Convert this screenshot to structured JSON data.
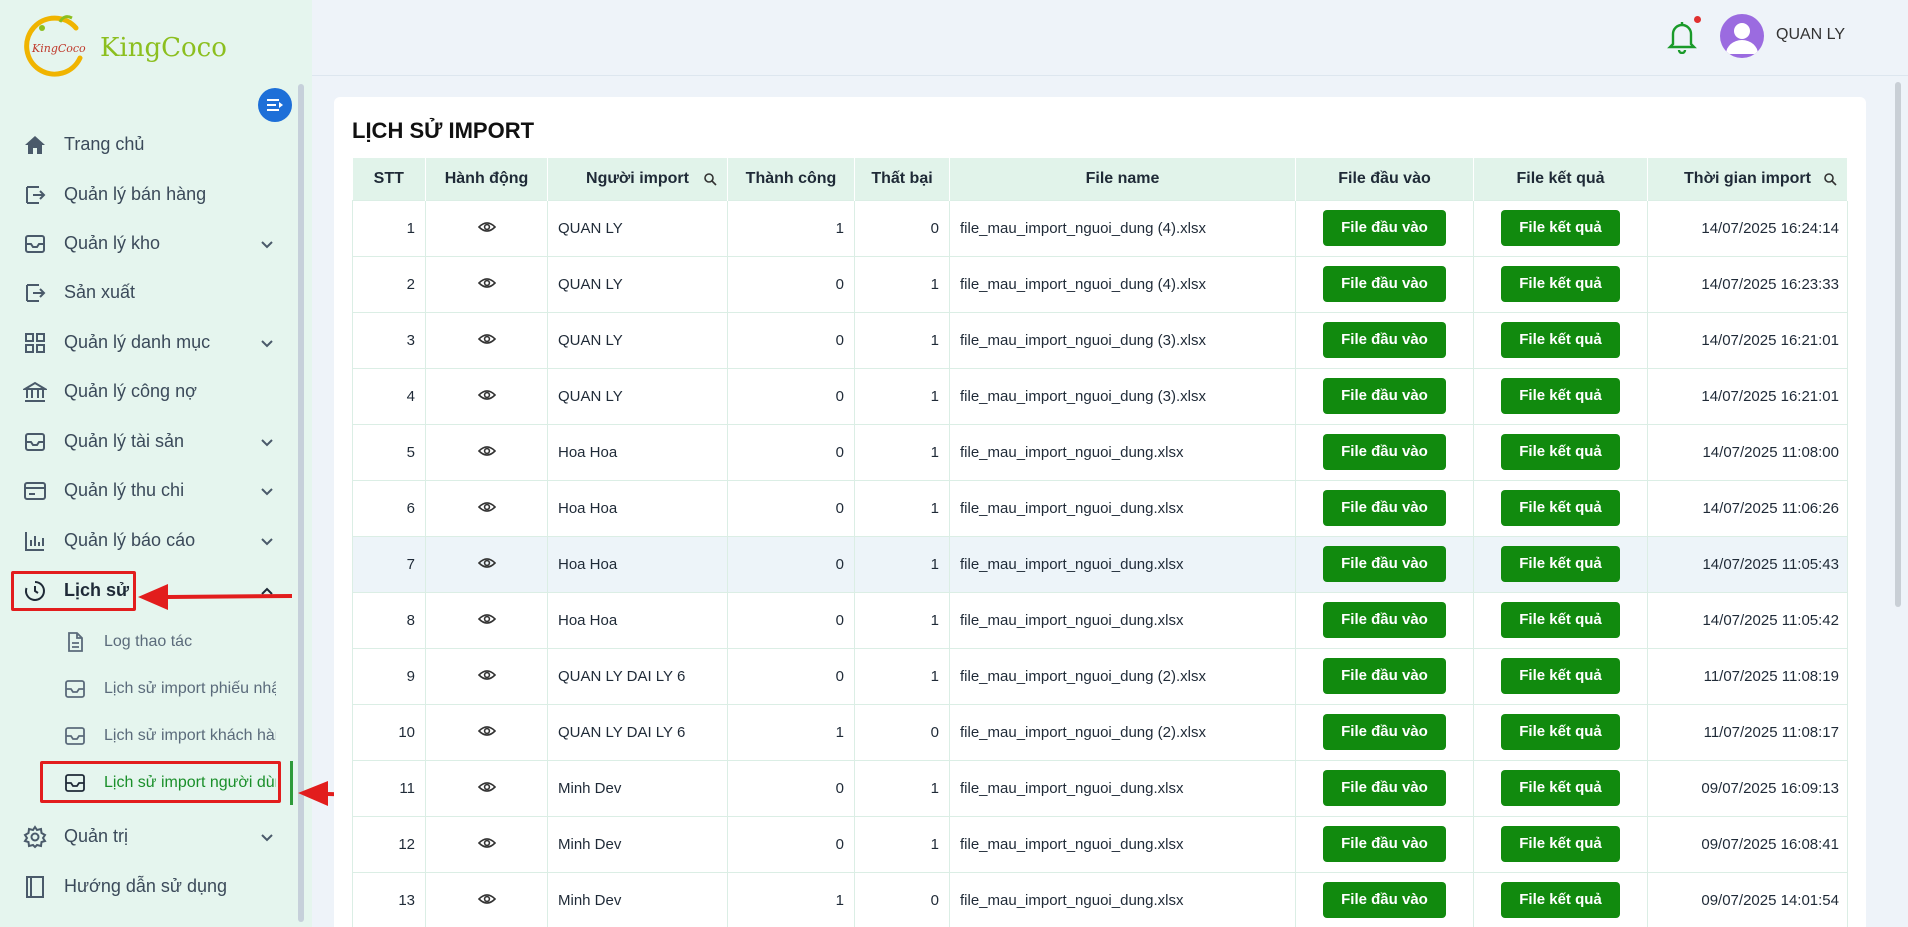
{
  "brand": {
    "name": "KingCoco",
    "mark_text": "KingCoco",
    "accent": "#8cbf1f"
  },
  "sidebar": {
    "items": [
      {
        "label": "Trang chủ",
        "icon": "home-icon",
        "has_chevron": false
      },
      {
        "label": "Quản lý bán hàng",
        "icon": "sales-icon",
        "has_chevron": false
      },
      {
        "label": "Quản lý kho",
        "icon": "inbox-icon",
        "has_chevron": true
      },
      {
        "label": "Sản xuất",
        "icon": "production-icon",
        "has_chevron": false
      },
      {
        "label": "Quản lý danh mục",
        "icon": "grid-icon",
        "has_chevron": true
      },
      {
        "label": "Quản lý công nợ",
        "icon": "bank-icon",
        "has_chevron": false
      },
      {
        "label": "Quản lý tài sản",
        "icon": "inbox-icon",
        "has_chevron": true
      },
      {
        "label": "Quản lý thu chi",
        "icon": "card-icon",
        "has_chevron": true
      },
      {
        "label": "Quản lý báo cáo",
        "icon": "bar-chart-icon",
        "has_chevron": true
      },
      {
        "label": "Lịch sử",
        "icon": "history-icon",
        "has_chevron": true,
        "expanded": true
      }
    ],
    "subitems": [
      {
        "label": "Log thao tác",
        "icon": "document-icon"
      },
      {
        "label": "Lịch sử import phiếu nhập",
        "icon": "inbox-icon"
      },
      {
        "label": "Lịch sử import khách hàng",
        "icon": "inbox-icon"
      },
      {
        "label": "Lịch sử import người dùng",
        "icon": "inbox-icon",
        "active": true
      }
    ],
    "bottom_items": [
      {
        "label": "Quản trị",
        "icon": "gear-icon",
        "has_chevron": true
      },
      {
        "label": "Hướng dẫn sử dụng",
        "icon": "book-icon",
        "has_chevron": false
      }
    ]
  },
  "header": {
    "username": "QUAN LY",
    "notification_icon": "bell-icon",
    "has_unread": true
  },
  "page": {
    "title": "LỊCH SỬ IMPORT"
  },
  "table": {
    "columns": [
      "STT",
      "Hành động",
      "Người import",
      "Thành công",
      "Thất bại",
      "File name",
      "File đầu vào",
      "File kết quả",
      "Thời gian import"
    ],
    "input_button_label": "File đầu vào",
    "result_button_label": "File kết quả",
    "rows": [
      {
        "stt": "1",
        "user": "QUAN LY",
        "success": "1",
        "fail": "0",
        "file": "file_mau_import_nguoi_dung (4).xlsx",
        "time": "14/07/2025 16:24:14"
      },
      {
        "stt": "2",
        "user": "QUAN LY",
        "success": "0",
        "fail": "1",
        "file": "file_mau_import_nguoi_dung (4).xlsx",
        "time": "14/07/2025 16:23:33"
      },
      {
        "stt": "3",
        "user": "QUAN LY",
        "success": "0",
        "fail": "1",
        "file": "file_mau_import_nguoi_dung (3).xlsx",
        "time": "14/07/2025 16:21:01"
      },
      {
        "stt": "4",
        "user": "QUAN LY",
        "success": "0",
        "fail": "1",
        "file": "file_mau_import_nguoi_dung (3).xlsx",
        "time": "14/07/2025 16:21:01"
      },
      {
        "stt": "5",
        "user": "Hoa Hoa",
        "success": "0",
        "fail": "1",
        "file": "file_mau_import_nguoi_dung.xlsx",
        "time": "14/07/2025 11:08:00"
      },
      {
        "stt": "6",
        "user": "Hoa Hoa",
        "success": "0",
        "fail": "1",
        "file": "file_mau_import_nguoi_dung.xlsx",
        "time": "14/07/2025 11:06:26"
      },
      {
        "stt": "7",
        "user": "Hoa Hoa",
        "success": "0",
        "fail": "1",
        "file": "file_mau_import_nguoi_dung.xlsx",
        "time": "14/07/2025 11:05:43"
      },
      {
        "stt": "8",
        "user": "Hoa Hoa",
        "success": "0",
        "fail": "1",
        "file": "file_mau_import_nguoi_dung.xlsx",
        "time": "14/07/2025 11:05:42"
      },
      {
        "stt": "9",
        "user": "QUAN LY DAI LY 6",
        "success": "0",
        "fail": "1",
        "file": "file_mau_import_nguoi_dung (2).xlsx",
        "time": "11/07/2025 11:08:19"
      },
      {
        "stt": "10",
        "user": "QUAN LY DAI LY 6",
        "success": "1",
        "fail": "0",
        "file": "file_mau_import_nguoi_dung (2).xlsx",
        "time": "11/07/2025 11:08:17"
      },
      {
        "stt": "11",
        "user": "Minh Dev",
        "success": "0",
        "fail": "1",
        "file": "file_mau_import_nguoi_dung.xlsx",
        "time": "09/07/2025 16:09:13"
      },
      {
        "stt": "12",
        "user": "Minh Dev",
        "success": "0",
        "fail": "1",
        "file": "file_mau_import_nguoi_dung.xlsx",
        "time": "09/07/2025 16:08:41"
      },
      {
        "stt": "13",
        "user": "Minh Dev",
        "success": "1",
        "fail": "0",
        "file": "file_mau_import_nguoi_dung.xlsx",
        "time": "09/07/2025 14:01:54"
      }
    ]
  },
  "colors": {
    "sidebar_bg": "#e5f5ee",
    "button_green": "#118a0e",
    "header_row": "#e1f3ea",
    "highlight_red": "#e21d1d"
  }
}
